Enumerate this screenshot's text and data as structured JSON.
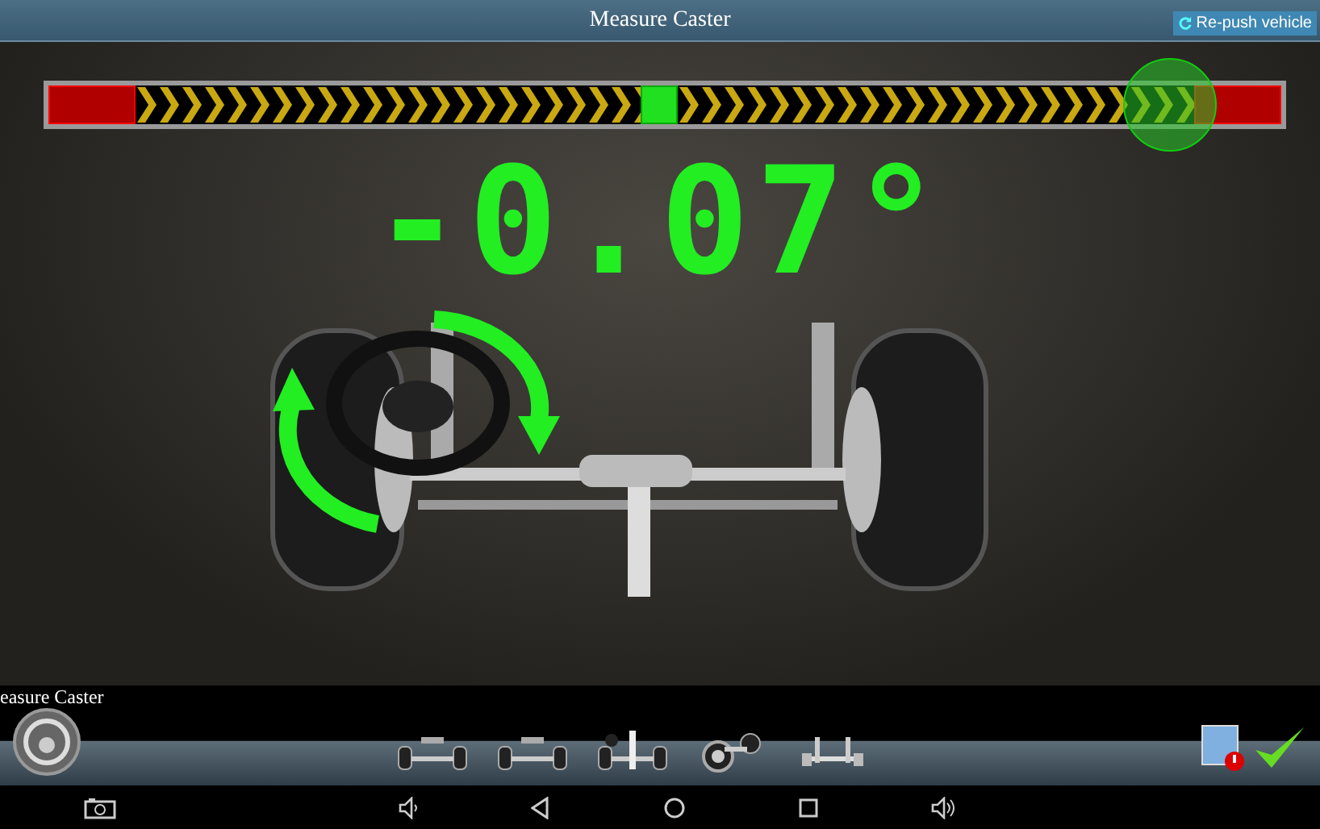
{
  "window": {
    "title": "Measure Caster"
  },
  "repush_button": {
    "label": "Re-push vehicle"
  },
  "gauge": {
    "level": 0.91
  },
  "reading": "-0.07°",
  "step_label": "easure Caster",
  "thumbnails": [
    {
      "kind": "axle"
    },
    {
      "kind": "axle"
    },
    {
      "kind": "column"
    },
    {
      "kind": "wheel"
    },
    {
      "kind": "frame"
    }
  ]
}
